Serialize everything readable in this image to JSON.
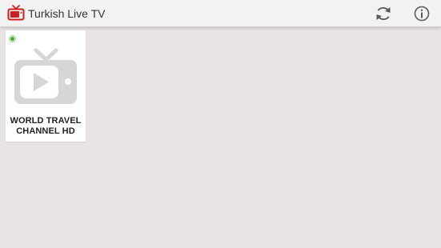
{
  "app": {
    "title": "Turkish Live TV",
    "icon": "tv-icon",
    "accent_color": "#cc1f1f"
  },
  "toolbar": {
    "actions": [
      {
        "icon": "refresh-icon"
      },
      {
        "icon": "info-icon"
      }
    ]
  },
  "channels": [
    {
      "name": "WORLD TRAVEL CHANNEL HD",
      "status": "online",
      "status_color": "#3fb52a",
      "thumbnail_icon": "tv-play-icon"
    }
  ]
}
